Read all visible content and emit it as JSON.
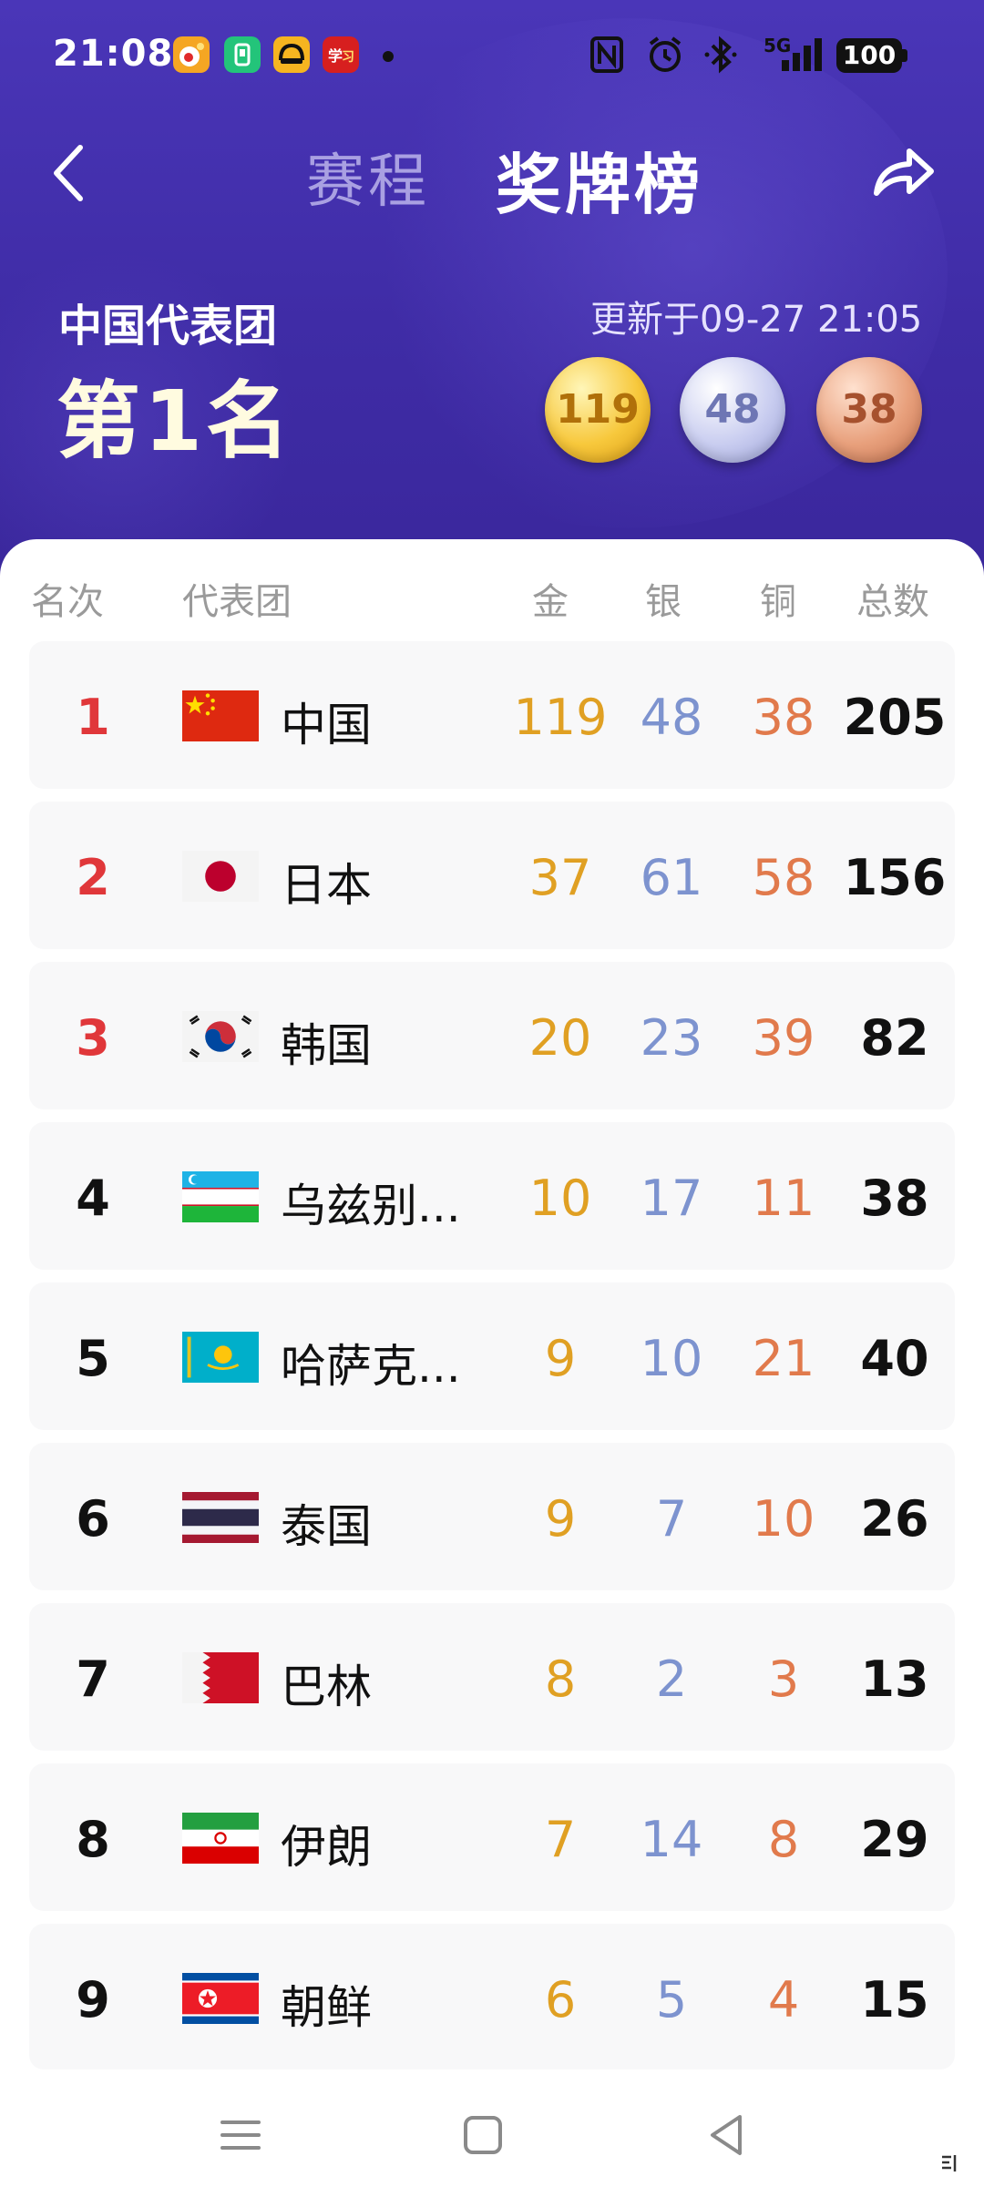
{
  "status_bar": {
    "time": "21:08",
    "network": "5G",
    "battery": "100",
    "icons": [
      "weibo-icon",
      "wallet-icon",
      "car-icon",
      "study-icon",
      "notification-dot",
      "nfc-icon",
      "alarm-icon",
      "bluetooth-icon",
      "signal-icon",
      "battery-icon"
    ]
  },
  "header": {
    "tab_schedule": "赛程",
    "tab_medals": "奖牌榜",
    "team_label": "中国代表团",
    "rank_text": "第1名",
    "updated": "更新于09-27 21:05",
    "medals": {
      "gold": "119",
      "silver": "48",
      "bronze": "38"
    }
  },
  "table": {
    "columns": [
      "名次",
      "代表团",
      "金",
      "银",
      "铜",
      "总数"
    ],
    "rows": [
      {
        "rank": "1",
        "name": "中国",
        "gold": "119",
        "silver": "48",
        "bronze": "38",
        "total": "205"
      },
      {
        "rank": "2",
        "name": "日本",
        "gold": "37",
        "silver": "61",
        "bronze": "58",
        "total": "156"
      },
      {
        "rank": "3",
        "name": "韩国",
        "gold": "20",
        "silver": "23",
        "bronze": "39",
        "total": "82"
      },
      {
        "rank": "4",
        "name": "乌兹别...",
        "gold": "10",
        "silver": "17",
        "bronze": "11",
        "total": "38"
      },
      {
        "rank": "5",
        "name": "哈萨克...",
        "gold": "9",
        "silver": "10",
        "bronze": "21",
        "total": "40"
      },
      {
        "rank": "6",
        "name": "泰国",
        "gold": "9",
        "silver": "7",
        "bronze": "10",
        "total": "26"
      },
      {
        "rank": "7",
        "name": "巴林",
        "gold": "8",
        "silver": "2",
        "bronze": "3",
        "total": "13"
      },
      {
        "rank": "8",
        "name": "伊朗",
        "gold": "7",
        "silver": "14",
        "bronze": "8",
        "total": "29"
      },
      {
        "rank": "9",
        "name": "朝鲜",
        "gold": "6",
        "silver": "5",
        "bronze": "4",
        "total": "15"
      }
    ]
  },
  "colors": {
    "header_bg": "#4a36b8",
    "gold": "#e0a023",
    "silver": "#7d93cf",
    "bronze": "#e17a4c",
    "top_rank": "#e0373a"
  }
}
